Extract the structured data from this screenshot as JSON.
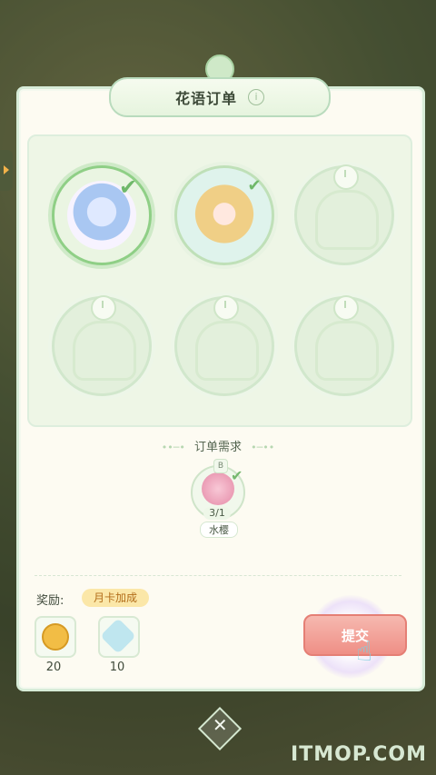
{
  "window": {
    "title": "花语订单"
  },
  "order": {
    "section_title": "订单需求",
    "item": {
      "name": "水樱",
      "count": "3/1",
      "badge": "B"
    }
  },
  "rewards": {
    "label": "奖励:",
    "bonus_tag": "月卡加成",
    "items": [
      {
        "name": "coin",
        "value": "20"
      },
      {
        "name": "exp",
        "value": "10"
      }
    ]
  },
  "submit_label": "提交",
  "watermark": "ITMOP.COM"
}
